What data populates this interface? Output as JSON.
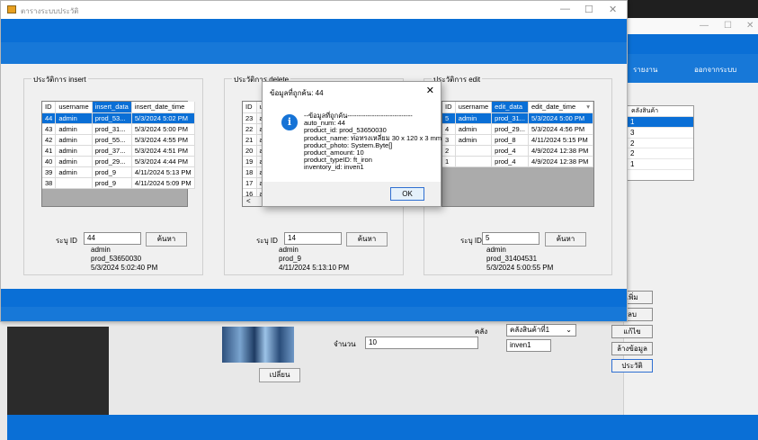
{
  "main_window": {
    "title": "ตารางระบบประวัติ",
    "controls": {
      "minimize": "—",
      "maximize": "☐",
      "close": "✕"
    }
  },
  "background_window": {
    "controls": {
      "minimize": "—",
      "maximize": "☐",
      "close": "✕"
    },
    "tabs": [
      "รายงาน",
      "ออกจากระบบ"
    ],
    "list_header": "คลังสินค้า",
    "list_items": [
      "1",
      "3",
      "2",
      "2",
      "1"
    ],
    "buttons": [
      "เพิ่ม",
      "ลบ",
      "แก้ไข",
      "ล้างข้อมูล",
      "ประวัติ"
    ],
    "qty_label": "จำนวน",
    "qty_value": "10",
    "warehouse_label": "คลัง",
    "warehouse_select": "คลังสินค้าที่1",
    "inventory_value": "inven1",
    "change_button": "เปลี่ยน"
  },
  "insert_panel": {
    "title": "ประวัติการ insert",
    "columns": [
      "ID",
      "username",
      "insert_data",
      "insert_date_time"
    ],
    "rows": [
      [
        "44",
        "admin",
        "prod_53...",
        "5/3/2024 5:02 PM"
      ],
      [
        "43",
        "admin",
        "prod_31...",
        "5/3/2024 5:00 PM"
      ],
      [
        "42",
        "admin",
        "prod_55...",
        "5/3/2024 4:55 PM"
      ],
      [
        "41",
        "admin",
        "prod_37...",
        "5/3/2024 4:51 PM"
      ],
      [
        "40",
        "admin",
        "prod_29...",
        "5/3/2024 4:44 PM"
      ],
      [
        "39",
        "admin",
        "prod_9",
        "4/11/2024 5:13 PM"
      ],
      [
        "38",
        "",
        "prod_9",
        "4/11/2024 5:09 PM"
      ]
    ],
    "search_label": "ระบุ ID",
    "search_value": "44",
    "search_button": "ค้นหา",
    "result_user": "admin",
    "result_data": "prod_53650030",
    "result_time": "5/3/2024 5:02:40 PM"
  },
  "delete_panel": {
    "title": "ประวัติการ delete",
    "columns": [
      "ID",
      "u"
    ],
    "rows": [
      [
        "23",
        "a"
      ],
      [
        "22",
        "a"
      ],
      [
        "21",
        "a"
      ],
      [
        "20",
        "a"
      ],
      [
        "19",
        "a"
      ],
      [
        "18",
        "a"
      ],
      [
        "17",
        "a"
      ],
      [
        "16",
        "a"
      ]
    ],
    "scroll_left": "<",
    "scroll_right": ">",
    "search_label": "ระบุ ID",
    "search_value": "14",
    "search_button": "ค้นหา",
    "result_user": "admin",
    "result_data": "prod_9",
    "result_time": "4/11/2024 5:13:10 PM"
  },
  "edit_panel": {
    "title": "ประวัติการ edit",
    "columns": [
      "ID",
      "username",
      "edit_data",
      "edit_date_time"
    ],
    "rows": [
      [
        "5",
        "admin",
        "prod_31...",
        "5/3/2024 5:00 PM"
      ],
      [
        "4",
        "admin",
        "prod_29...",
        "5/3/2024 4:56 PM"
      ],
      [
        "3",
        "admin",
        "prod_8",
        "4/11/2024 5:15 PM"
      ],
      [
        "2",
        "",
        "prod_4",
        "4/9/2024 12:38 PM"
      ],
      [
        "1",
        "",
        "prod_4",
        "4/9/2024 12:38 PM"
      ]
    ],
    "sort_glyph": "▾",
    "search_label": "ระบุ ID",
    "search_value": "5",
    "search_button": "ค้นหา",
    "result_user": "admin",
    "result_data": "prod_31404531",
    "result_time": "5/3/2024 5:00:55 PM"
  },
  "message_box": {
    "title": "ข้อมูลที่ถูกค้น: 44",
    "close": "✕",
    "icon_glyph": "i",
    "body": "--ข้อมูลที่ถูกค้น-----------------------------\nauto_num: 44\nproduct_id: prod_53650030\nproduct_name: ท่อทรงเหลี่ยม 30 x 120 x 3 mm\nproduct_photo: System.Byte[]\nproduct_amount: 10\nproduct_typeID: ft_iron\ninventory_id: inven1",
    "ok_button": "OK"
  },
  "colors": {
    "accent": "#0a6fd6",
    "accent_light": "#1778d8",
    "selection": "#0a6fd6"
  }
}
